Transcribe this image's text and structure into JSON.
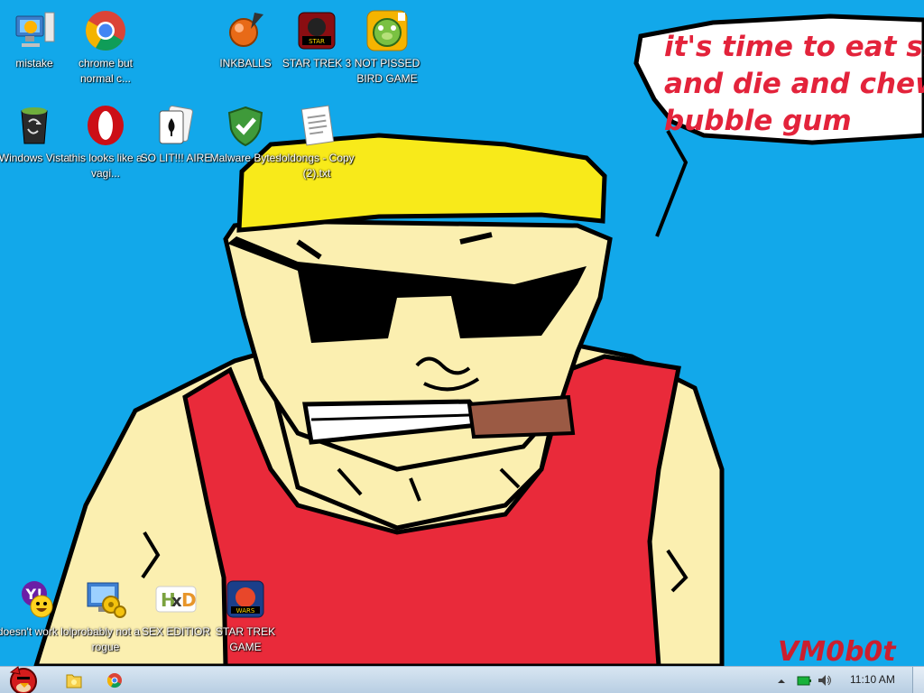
{
  "desktop": {
    "icons": [
      {
        "label": "mistake",
        "icon": "computer-settings-icon"
      },
      {
        "label": "chrome but normal c...",
        "icon": "chrome-icon"
      },
      {
        "label": "INKBALLS",
        "icon": "inkball-icon"
      },
      {
        "label": "STAR TREK 3",
        "icon": "star-wars-game-icon"
      },
      {
        "label": "NOT PISSED BIRD GAME",
        "icon": "bad-piggies-icon"
      },
      {
        "label": "Windows Vista",
        "icon": "recycle-bin-icon"
      },
      {
        "label": "this looks like a vagi...",
        "icon": "opera-icon"
      },
      {
        "label": "SO LIT!!! AIRE",
        "icon": "solitaire-icon"
      },
      {
        "label": "Malware Bytes",
        "icon": "shield-check-icon"
      },
      {
        "label": "loldongs - Copy (2).txt",
        "icon": "text-file-icon"
      },
      {
        "label": "doesn't work lol",
        "icon": "yahoo-messenger-icon"
      },
      {
        "label": "probably not a rogue",
        "icon": "settings-computer-icon"
      },
      {
        "label": "SEX EDITIOR",
        "icon": "hxd-icon"
      },
      {
        "label": "STAR TREK GAME",
        "icon": "star-wars-game-icon"
      }
    ]
  },
  "wallpaper": {
    "speech_lines": [
      "it's time to eat shit",
      "and die and chew",
      "bubble gum"
    ],
    "signature": "VM0b0t",
    "background_color": "#12a8ea"
  },
  "taskbar": {
    "start_icon": "angry-bird-start-icon",
    "pinned": [
      {
        "name": "explorer",
        "icon": "folder-icon"
      },
      {
        "name": "chrome",
        "icon": "chrome-icon"
      }
    ],
    "tray": {
      "clock": "11:10 AM",
      "icons": [
        "tray-arrow-icon",
        "battery-icon",
        "volume-icon"
      ]
    }
  }
}
